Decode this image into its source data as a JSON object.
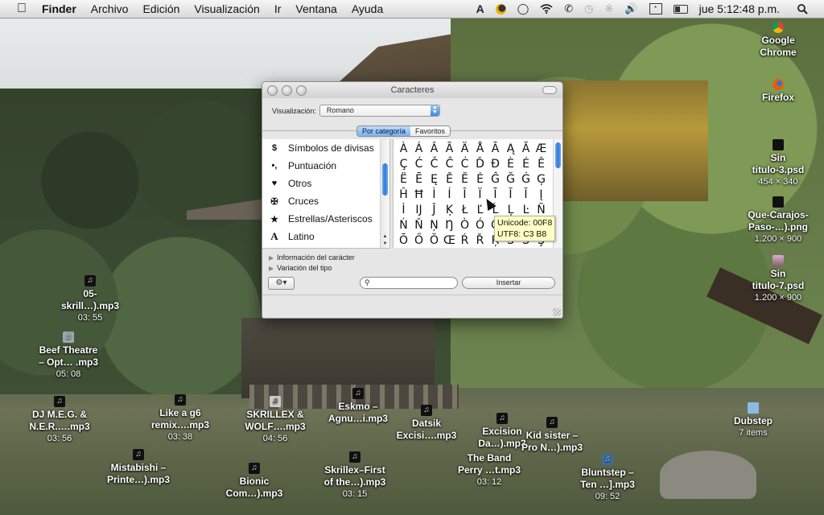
{
  "menubar": {
    "apple_icon": "apple-icon",
    "items": [
      {
        "label": "Finder",
        "bold": true
      },
      {
        "label": "Archivo"
      },
      {
        "label": "Edición"
      },
      {
        "label": "Visualización"
      },
      {
        "label": "Ir"
      },
      {
        "label": "Ventana"
      },
      {
        "label": "Ayuda"
      }
    ],
    "status_icons": [
      "adobe-icon",
      "norton-icon",
      "growl-icon",
      "wifi-icon",
      "phone-icon",
      "time-machine-icon",
      "bluetooth-icon",
      "volume-icon",
      "keyboard-viewer-icon",
      "battery-icon"
    ],
    "clock": "jue 5:12:48 p.m.",
    "spotlight_icon": "spotlight-icon"
  },
  "window": {
    "title": "Caracteres",
    "view_label": "Visualización:",
    "view_value": "Romano",
    "tabs": [
      {
        "label": "Por categoría",
        "active": true
      },
      {
        "label": "Favoritos",
        "active": false
      }
    ],
    "categories": [
      {
        "icon": "$",
        "label": "Símbolos de divisas"
      },
      {
        "icon": "•,",
        "label": "Puntuación"
      },
      {
        "icon": "♥",
        "label": "Otros"
      },
      {
        "icon": "✠",
        "label": "Cruces"
      },
      {
        "icon": "★",
        "label": "Estrellas/Asteriscos"
      },
      {
        "icon": "A",
        "label": "Latino"
      }
    ],
    "characters": [
      "À",
      "Á",
      "Â",
      "Ã",
      "Ä",
      "Å",
      "Ā",
      "Ą",
      "Ă",
      "Æ",
      "Ç",
      "Ć",
      "Č",
      "Ĉ",
      "Ċ",
      "Ď",
      "Đ",
      "È",
      "É",
      "Ê",
      "Ë",
      "Ē",
      "Ę",
      "Ě",
      "Ĕ",
      "Ė",
      "Ĝ",
      "Ğ",
      "Ġ",
      "Ģ",
      "Ĥ",
      "Ħ",
      "Ì",
      "Í",
      "Î",
      "Ï",
      "Ī",
      "Ĩ",
      "Ĭ",
      "Į",
      "İ",
      "Ĳ",
      "Ĵ",
      "Ķ",
      "Ł",
      "Ľ",
      "Ĺ",
      "Ļ",
      "Ŀ",
      "Ñ",
      "Ń",
      "Ň",
      "Ņ",
      "Ŋ",
      "Ò",
      "Ó",
      "Ô",
      "Õ",
      "Ö",
      "Ø",
      "Ō",
      "Ő",
      "Ŏ",
      "Œ",
      "Ŕ",
      "Ř",
      "Ŗ",
      "Ś",
      "Š",
      "Ş"
    ],
    "tooltip": {
      "unicode": "Unicode: 00F8",
      "utf8": "UTF8: C3 B8"
    },
    "disclosures": [
      "Información del carácter",
      "Variación del tipo"
    ],
    "search_value": "",
    "search_placeholder": "",
    "insert_label": "Insertar"
  },
  "desktop_icons": [
    {
      "name": "Google Chrome",
      "lines": [
        "Google",
        "Chrome"
      ],
      "type": "app",
      "icon": "chrome-icon"
    },
    {
      "name": "Firefox",
      "lines": [
        "Firefox"
      ],
      "type": "app",
      "icon": "firefox-icon"
    },
    {
      "name": "Sin titulo-3.psd",
      "lines": [
        "Sin",
        "titulo-3.psd"
      ],
      "sub": "454 × 340",
      "type": "image",
      "icon": "psd-icon"
    },
    {
      "name": "Que-Carajos-Paso-...).png",
      "lines": [
        "Que-Carajos-",
        "Paso-…).png"
      ],
      "sub": "1.200 × 900",
      "type": "image",
      "icon": "png-icon"
    },
    {
      "name": "Sin titulo-7.psd",
      "lines": [
        "Sin",
        "titulo-7.psd"
      ],
      "sub": "1.200 × 900",
      "type": "image",
      "icon": "psd-icon"
    },
    {
      "name": "05-skrill...).mp3",
      "lines": [
        "05-",
        "skrill…).mp3"
      ],
      "sub": "03: 55",
      "type": "audio",
      "icon": "music-file-icon"
    },
    {
      "name": "Beef Theatre - Opt... .mp3",
      "lines": [
        "Beef Theatre",
        "– Opt… .mp3"
      ],
      "sub": "05: 08",
      "type": "audio",
      "icon": "music-file-icon"
    },
    {
      "name": "DJ M.E.G. & N.E.R....mp3",
      "lines": [
        "DJ M.E.G. &",
        "N.E.R.….mp3"
      ],
      "sub": "03: 56",
      "type": "audio",
      "icon": "music-file-icon"
    },
    {
      "name": "Like a g6 remix....mp3",
      "lines": [
        "Like a g6",
        "remix….mp3"
      ],
      "sub": "03: 38",
      "type": "audio",
      "icon": "music-file-icon"
    },
    {
      "name": "SKRILLEX & WOLF....mp3",
      "lines": [
        "SKRILLEX &",
        "WOLF….mp3"
      ],
      "sub": "04: 56",
      "type": "audio",
      "icon": "music-file-icon"
    },
    {
      "name": "Eskmo - Agnu...i.mp3",
      "lines": [
        "Eskmo –",
        "Agnu…i.mp3"
      ],
      "type": "audio",
      "icon": "music-file-icon"
    },
    {
      "name": "Datsik Excisi....mp3",
      "lines": [
        "Datsik",
        "Excisi….mp3"
      ],
      "type": "audio",
      "icon": "music-file-icon"
    },
    {
      "name": "Excision Da...).mp3",
      "lines": [
        "Excision",
        "Da…).mp3"
      ],
      "type": "audio",
      "icon": "music-file-icon"
    },
    {
      "name": "Kid sister - Pro N...).mp3",
      "lines": [
        "Kid sister –",
        "Pro N…).mp3"
      ],
      "type": "audio",
      "icon": "music-file-icon"
    },
    {
      "name": "The Band Perry ...t.mp3",
      "lines": [
        "The Band",
        "Perry …t.mp3"
      ],
      "sub": "03: 12",
      "type": "audio",
      "icon": "music-file-icon"
    },
    {
      "name": "Mistabishi - Printe...).mp3",
      "lines": [
        "Mistabishi –",
        "Printe…).mp3"
      ],
      "type": "audio",
      "icon": "music-file-icon"
    },
    {
      "name": "Bionic Com...).mp3",
      "lines": [
        "Bionic",
        "Com…).mp3"
      ],
      "type": "audio",
      "icon": "music-file-icon"
    },
    {
      "name": "Skrillex-First of the...).mp3",
      "lines": [
        "Skrillex–First",
        "of the…).mp3"
      ],
      "sub": "03: 15",
      "type": "audio",
      "icon": "music-file-icon"
    },
    {
      "name": "Bluntstep - Ten ...].mp3",
      "lines": [
        "Bluntstep –",
        "Ten …].mp3"
      ],
      "sub": "09: 52",
      "type": "audio",
      "icon": "music-file-icon"
    },
    {
      "name": "Dubstep",
      "lines": [
        "Dubstep"
      ],
      "sub": "7 items",
      "type": "folder",
      "icon": "folder-icon"
    }
  ]
}
